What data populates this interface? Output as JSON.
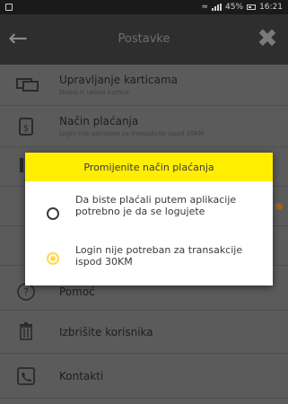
{
  "status_bar": {
    "battery": "45%",
    "time": "16:21"
  },
  "app_bar": {
    "title": "Postavke"
  },
  "settings": {
    "items": [
      {
        "title": "Upravljanje karticama",
        "subtitle": "Dodaj ili ukloni kartice",
        "icon": "card-icon"
      },
      {
        "title": "Način plaćanja",
        "subtitle": "Login nije potreban za transakcije ispod 30KM",
        "icon": "payment-icon"
      },
      {
        "title": "Pomoć",
        "subtitle": "",
        "icon": "help-icon"
      },
      {
        "title": "Izbrišite korisnika",
        "subtitle": "",
        "icon": "trash-icon"
      },
      {
        "title": "Kontakti",
        "subtitle": "",
        "icon": "contacts-icon"
      }
    ]
  },
  "dialog": {
    "title": "Promijenite način plaćanja",
    "options": [
      {
        "label": "Da biste plaćali putem aplikacije potrebno je da se logujete",
        "selected": false
      },
      {
        "label": "Login nije potreban za transakcije ispod 30KM",
        "selected": true
      }
    ]
  },
  "colors": {
    "accent": "#ffee00",
    "radio_selected": "#ffd84d",
    "badge": "#a3621a"
  }
}
